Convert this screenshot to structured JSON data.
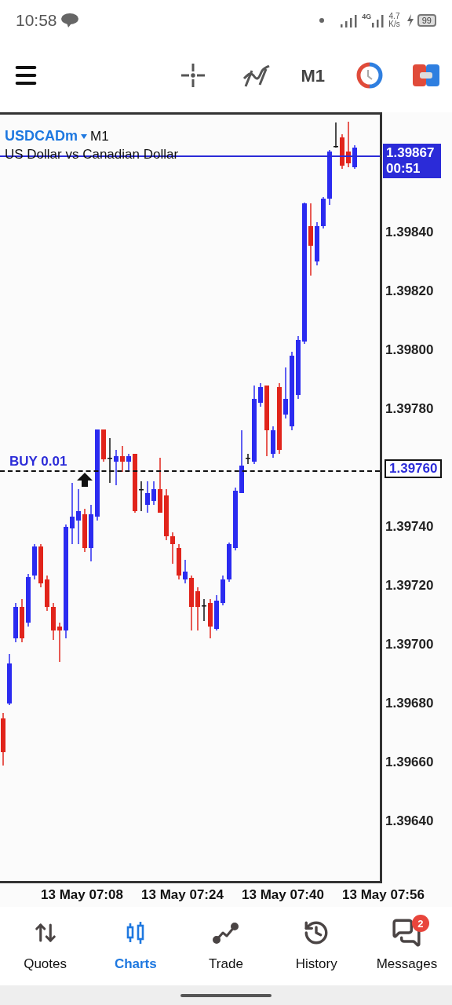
{
  "status_bar": {
    "time": "10:58",
    "network_type": "4G",
    "speed": "4.7",
    "speed_unit": "K/s",
    "battery": "99"
  },
  "toolbar": {
    "timeframe": "M1"
  },
  "chart": {
    "symbol": "USDCADm",
    "timeframe": "M1",
    "description": "US Dollar vs Canadian Dollar",
    "order_label": "BUY 0.01",
    "order_price": "1.39760",
    "current_price": "1.39867",
    "countdown": "00:51",
    "price_ticks": [
      "1.39840",
      "1.39820",
      "1.39800",
      "1.39780",
      "1.39740",
      "1.39720",
      "1.39700",
      "1.39680",
      "1.39660",
      "1.39640"
    ],
    "time_ticks": [
      "13 May 07:08",
      "13 May 07:24",
      "13 May 07:40",
      "13 May 07:56"
    ]
  },
  "nav": [
    {
      "label": "Quotes",
      "selected": false,
      "kind": "quotes"
    },
    {
      "label": "Charts",
      "selected": true,
      "kind": "charts"
    },
    {
      "label": "Trade",
      "selected": false,
      "kind": "trade"
    },
    {
      "label": "History",
      "selected": false,
      "kind": "history"
    },
    {
      "label": "Messages",
      "selected": false,
      "kind": "messages",
      "badge": "2"
    }
  ]
}
